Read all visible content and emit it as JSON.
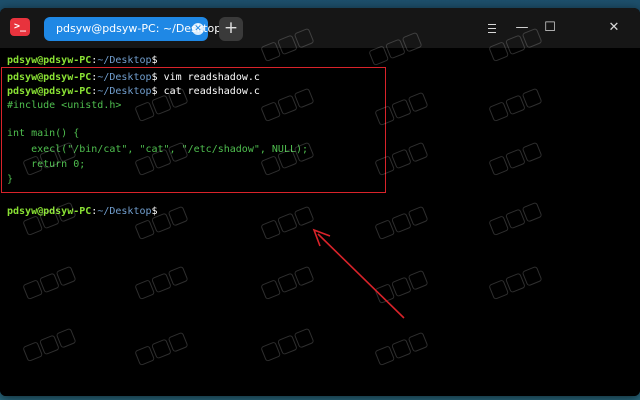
{
  "window": {
    "tab_title": "pdsyw@pdsyw-PC: ~/Desktop",
    "app_icon_glyph": ">_",
    "new_tab_glyph": "+",
    "close_glyph": "✕",
    "minimize_glyph": "—",
    "maximize_glyph": "☐",
    "tab_close_glyph": "✕"
  },
  "terminal": {
    "prompt_user": "pdsyw@pdsyw-PC",
    "prompt_colon": ":",
    "prompt_path": "~/Desktop",
    "prompt_dollar": "$",
    "commands": {
      "line2": " vim readshadow.c",
      "line3": " cat readshadow.c"
    },
    "code_lines": [
      "#include <unistd.h>",
      "",
      "int main() {",
      "    execl(\"/bin/cat\", \"cat\", \"/etc/shadow\", NULL);",
      "    return 0;",
      "}"
    ]
  },
  "colors": {
    "user": "#8ae234",
    "path": "#729fcf",
    "code": "#4fbf4f",
    "annotation": "#d9232a",
    "tab": "#1f88e5"
  }
}
